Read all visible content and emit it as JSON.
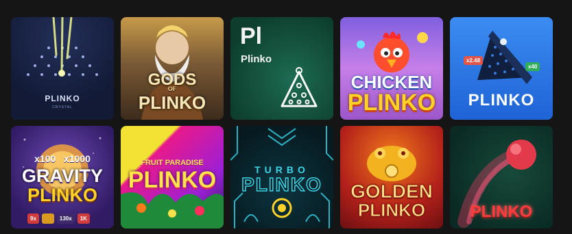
{
  "games": [
    {
      "id": "plinko-crystal",
      "title": "PLINKO",
      "subtitle": "CRYSTAL"
    },
    {
      "id": "gods-of-plinko",
      "line1": "GODS",
      "line2": "OF",
      "line3": "PLINKO"
    },
    {
      "id": "plinko-pl",
      "short": "Pl",
      "name": "Plinko"
    },
    {
      "id": "chicken-plinko",
      "line1": "CHICKEN",
      "line2": "PLINKO"
    },
    {
      "id": "plinko-blue",
      "title": "PLINKO",
      "badge_left": "x2.48",
      "badge_right": "x40"
    },
    {
      "id": "gravity-plinko",
      "mult1": "x100",
      "mult2": "x1000",
      "line1": "GRAVITY",
      "line2": "PLINKO",
      "chips": [
        "9x",
        "130x",
        "1K"
      ]
    },
    {
      "id": "fruit-paradise-plinko",
      "line1": "FRUIT PARADISE",
      "line2": "PLINKO"
    },
    {
      "id": "turbo-plinko",
      "line1": "TURBO",
      "line2": "PLINKO"
    },
    {
      "id": "golden-plinko",
      "line1": "GOLDEN",
      "line2": "PLINKO"
    },
    {
      "id": "plinko-red",
      "title": "PLINKO"
    }
  ],
  "colors": {
    "page_background": "#151515",
    "accent_yellow": "#ffd227",
    "accent_red": "#ff3b3b",
    "accent_cyan": "#3ad6e8"
  }
}
